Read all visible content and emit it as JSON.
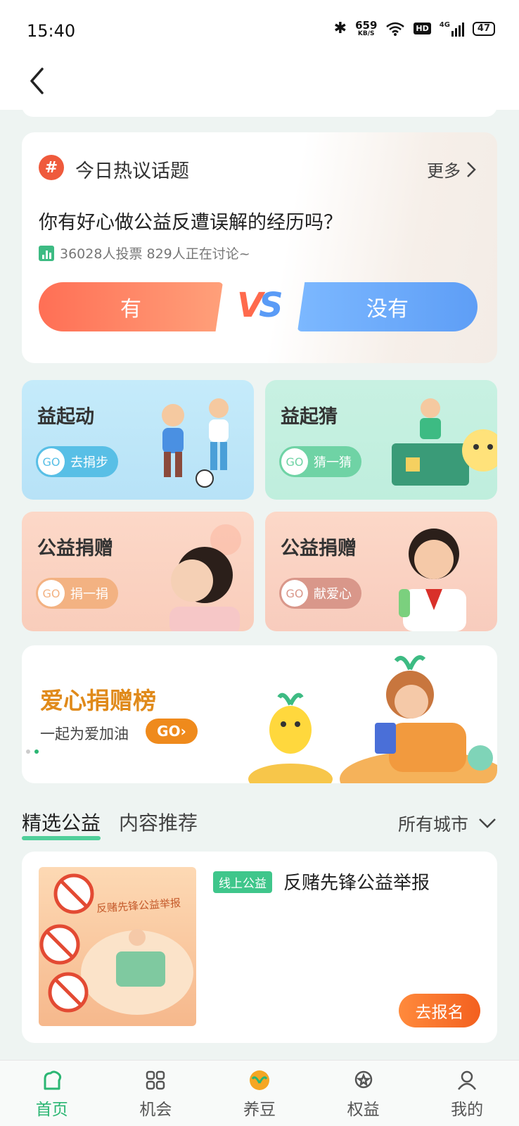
{
  "status_bar": {
    "time": "15:40",
    "net_speed": "659",
    "net_unit": "KB/S",
    "hd": "HD",
    "signal_label": "4G",
    "battery": "47"
  },
  "topic": {
    "title": "今日热议话题",
    "more": "更多",
    "question": "你有好心做公益反遭误解的经历吗？",
    "stats": "36028人投票 829人正在讨论~",
    "yes_label": "有",
    "vs_v": "V",
    "vs_s": "S",
    "no_label": "没有"
  },
  "tiles": [
    {
      "title": "益起动",
      "go": "GO",
      "action": "去捐步"
    },
    {
      "title": "益起猜",
      "go": "GO",
      "action": "猜一猜"
    },
    {
      "title": "公益捐赠",
      "go": "GO",
      "action": "捐一捐"
    },
    {
      "title": "公益捐赠",
      "go": "GO",
      "action": "献爱心"
    }
  ],
  "banner": {
    "title": "爱心捐赠榜",
    "subtitle": "一起为爱加油",
    "go": "GO›"
  },
  "section": {
    "tabs": [
      "精选公益",
      "内容推荐"
    ],
    "active_tab": 0,
    "city": "所有城市"
  },
  "project": {
    "tag": "线上公益",
    "title": "反赌先锋公益举报",
    "image_text": "反赌先锋公益举报",
    "button": "去报名"
  },
  "bottom_nav": [
    {
      "label": "首页",
      "icon": "home-icon",
      "active": true
    },
    {
      "label": "机会",
      "icon": "grid-icon",
      "active": false
    },
    {
      "label": "养豆",
      "icon": "sprout-icon",
      "active": false
    },
    {
      "label": "权益",
      "icon": "badge-icon",
      "active": false
    },
    {
      "label": "我的",
      "icon": "user-icon",
      "active": false
    }
  ],
  "colors": {
    "accent_green": "#2bb673",
    "orange": "#f3601f"
  }
}
